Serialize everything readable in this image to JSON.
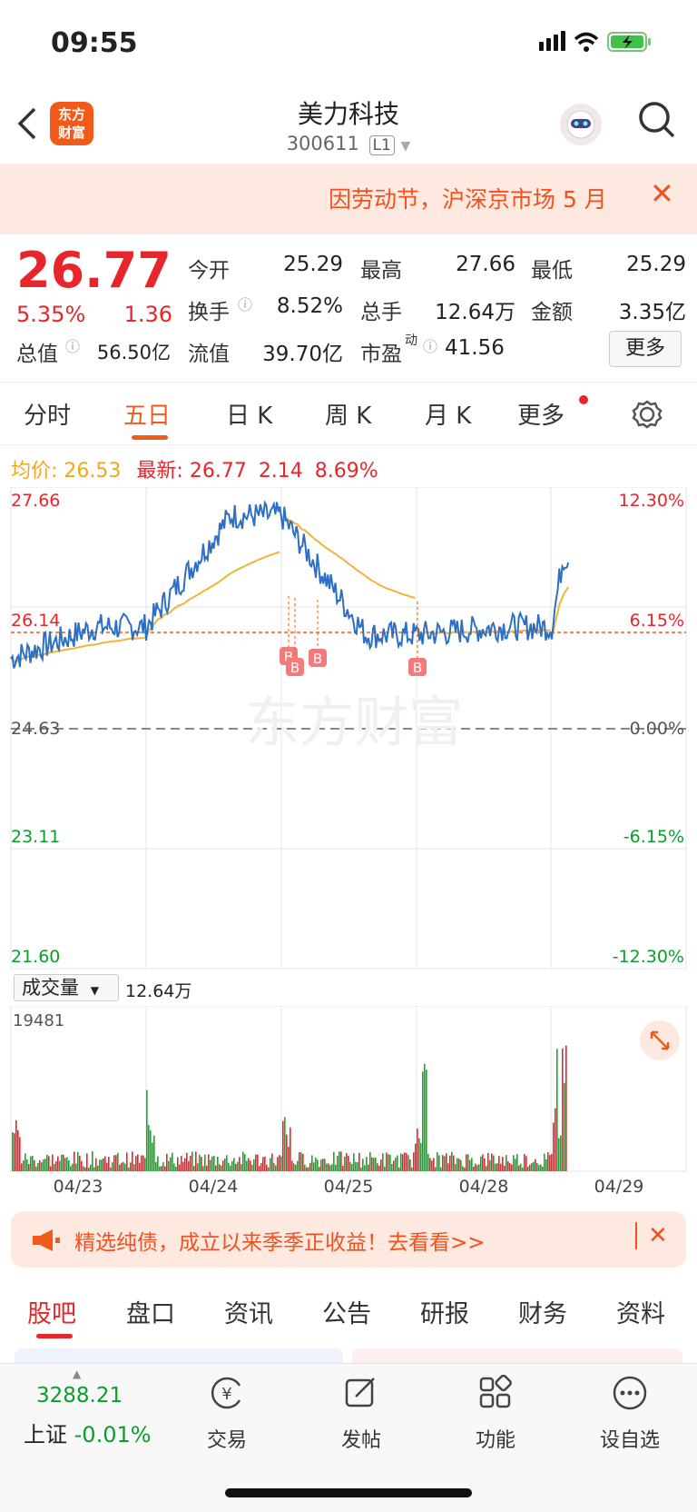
{
  "status_bar": {
    "time": "09:55"
  },
  "header": {
    "back_icon": "chevron-left-icon",
    "logo_text_top": "东方",
    "logo_text_bottom": "财富",
    "stock_name": "美力科技",
    "stock_code": "300611",
    "level_badge": "L1"
  },
  "notice_banner": {
    "text": "因劳动节，沪深京市场 5 月",
    "close": "✕"
  },
  "quote": {
    "price": "26.77",
    "change_pct": "5.35%",
    "change_amt": "1.36",
    "open_label": "今开",
    "open": "25.29",
    "high_label": "最高",
    "high": "27.66",
    "low_label": "最低",
    "low": "25.29",
    "turnover_label": "换手",
    "turnover": "8.52%",
    "volume_label": "总手",
    "volume": "12.64万",
    "amount_label": "金额",
    "amount": "3.35亿",
    "mktcap_label": "总值",
    "mktcap": "56.50亿",
    "float_label": "流值",
    "float_cap": "39.70亿",
    "pe_label": "市盈",
    "pe_sup": "动",
    "pe": "41.56",
    "more_button": "更多"
  },
  "chart_tabs": [
    {
      "label": "分时",
      "active": false
    },
    {
      "label": "五日",
      "active": true
    },
    {
      "label": "日 K",
      "active": false
    },
    {
      "label": "周 K",
      "active": false
    },
    {
      "label": "月 K",
      "active": false
    },
    {
      "label": "更多",
      "active": false
    }
  ],
  "avg_line": {
    "avg_label": "均价:",
    "avg_value": "26.53",
    "latest_label": "最新:",
    "latest_value": "26.77",
    "latest_change": "2.14",
    "latest_pct": "8.69%"
  },
  "price_chart": {
    "y_left": [
      "27.66",
      "26.14",
      "24.63",
      "23.11",
      "21.60"
    ],
    "y_right": [
      "12.30%",
      "6.15%",
      "0.00%",
      "-6.15%",
      "-12.30%"
    ],
    "watermark": "东方财富",
    "marker_label": "B"
  },
  "volume_chart": {
    "selector_label": "成交量",
    "total": "12.64万",
    "max_label": "19481",
    "x_labels": [
      "04/23",
      "04/24",
      "04/25",
      "04/28",
      "04/29"
    ]
  },
  "chart_data": {
    "type": "line",
    "x": [
      "04/23",
      "04/24",
      "04/25",
      "04/28",
      "04/29"
    ],
    "ylim": [
      21.6,
      27.66
    ],
    "prev_close": 24.63,
    "series": [
      {
        "name": "",
        "values": [
          25.9,
          27.3,
          25.8,
          25.9,
          26.77
        ]
      }
    ]
  },
  "promo": {
    "text": "精选纯债，成立以来季季正收益！去看看>>",
    "close": "✕"
  },
  "sub_tabs": [
    "股吧",
    "盘口",
    "资讯",
    "公告",
    "研报",
    "财务",
    "资料"
  ],
  "bottom_nav": {
    "index_value": "3288.21",
    "index_name": "上证",
    "index_change": "-0.01%",
    "items": [
      "交易",
      "发帖",
      "功能",
      "设自选"
    ]
  }
}
